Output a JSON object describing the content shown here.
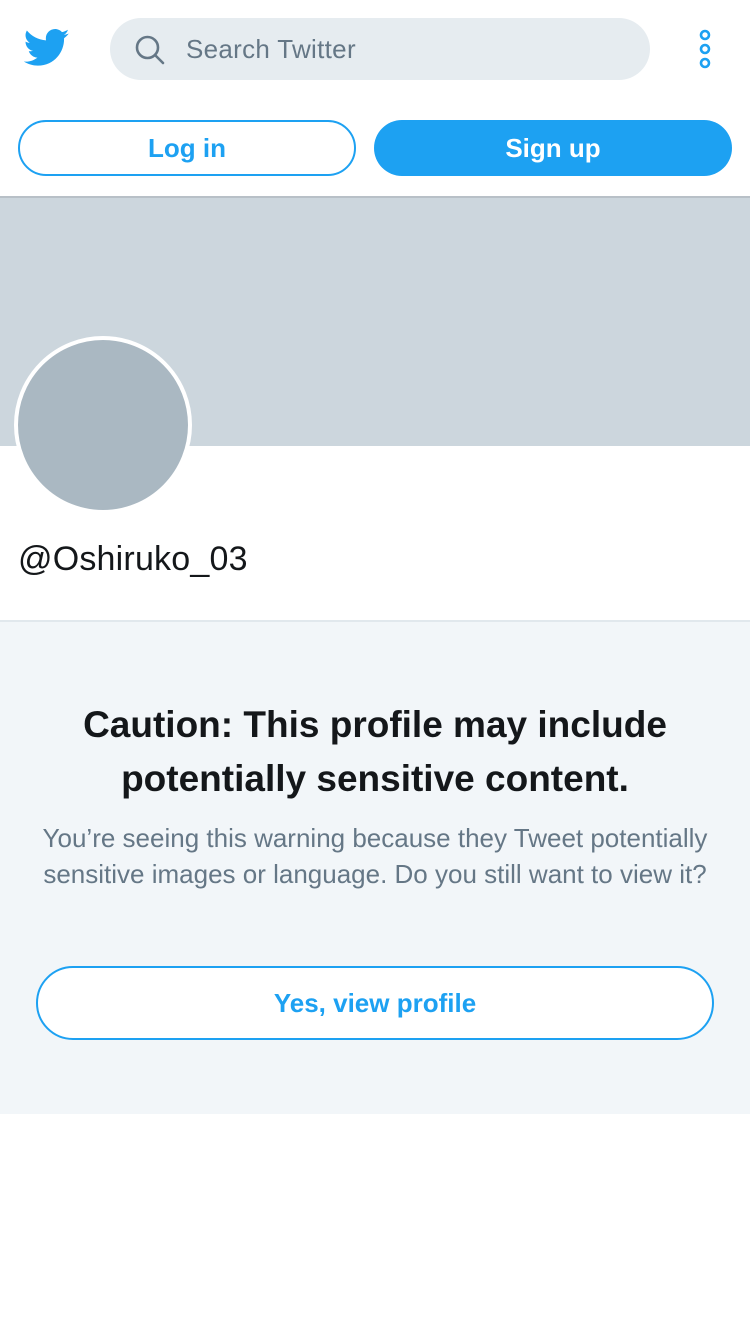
{
  "header": {
    "logo_icon": "twitter-bird-icon",
    "search": {
      "icon": "search-icon",
      "placeholder": "Search Twitter"
    },
    "more_icon": "more-vertical-icon"
  },
  "auth": {
    "login_label": "Log in",
    "signup_label": "Sign up"
  },
  "profile": {
    "handle": "@Oshiruko_03"
  },
  "caution": {
    "title": "Caution: This profile may include potentially sensitive content.",
    "body": "You’re seeing this warning because they Tweet potentially sensitive images or language. Do you still want to view it?",
    "view_label": "Yes, view profile"
  },
  "colors": {
    "accent": "#1da1f2",
    "banner": "#ccd6dd",
    "avatar": "#aab8c2",
    "panel_bg": "#f2f6f9",
    "search_bg": "#e6ecf0",
    "muted_text": "#657786",
    "primary_text": "#14171a"
  }
}
